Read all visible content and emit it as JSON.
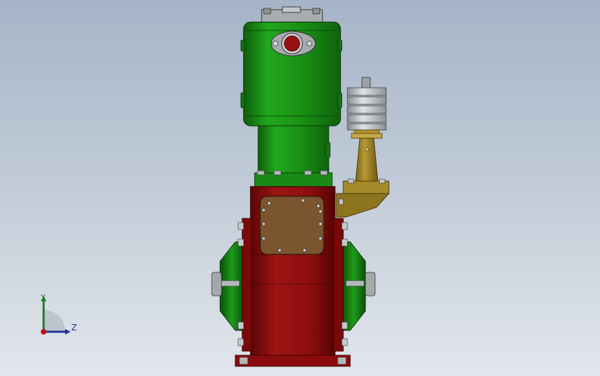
{
  "viewport": {
    "background_top": "#a6b4c8",
    "background_bottom": "#e2e6ec"
  },
  "model": {
    "colors": {
      "head": "#1e9a18",
      "head_dark": "#137010",
      "body": "#9a1010",
      "body_dark": "#6a0606",
      "access_cover": "#7a5530",
      "bracket": "#a58a2a",
      "fins": "#b8bcc0"
    }
  },
  "triad": {
    "y_label": "Y",
    "z_label": "Z",
    "y_color": "#1d7a2a",
    "z_color": "#22309a",
    "origin_color": "#c01010"
  }
}
